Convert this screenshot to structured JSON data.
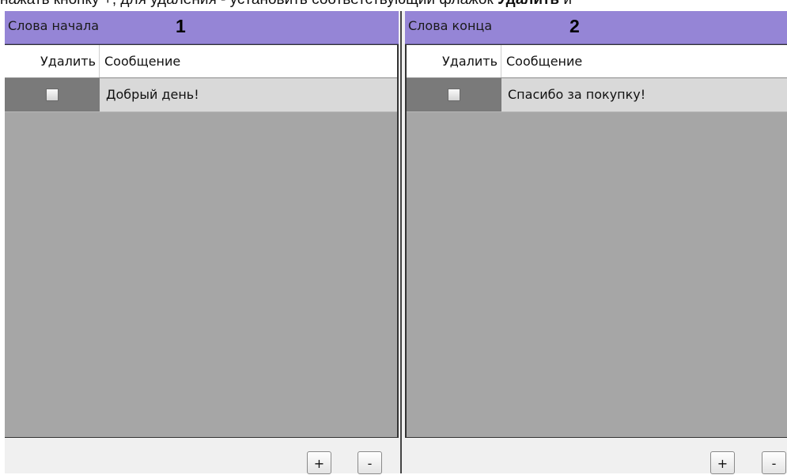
{
  "top_note": {
    "before": "нажать кнопку +, для удаления - установить соответствующий флажок ",
    "bold": "Удалить",
    "after": " и"
  },
  "left_panel": {
    "title": "Слова начала",
    "number": "1",
    "columns": {
      "delete": "Удалить",
      "message": "Сообщение"
    },
    "rows": [
      {
        "checked": false,
        "message": "Добрый день!"
      }
    ],
    "buttons": {
      "add": "+",
      "remove": "-"
    }
  },
  "right_panel": {
    "title": "Слова конца",
    "number": "2",
    "columns": {
      "delete": "Удалить",
      "message": "Сообщение"
    },
    "rows": [
      {
        "checked": false,
        "message": "Спасибо за покупку!"
      }
    ],
    "buttons": {
      "add": "+",
      "remove": "-"
    }
  },
  "colors": {
    "header_bg": "#9585d6",
    "grid_bg": "#a6a6a6",
    "row_bg": "#d9d9d9",
    "check_cell_bg": "#7a7a7a"
  }
}
